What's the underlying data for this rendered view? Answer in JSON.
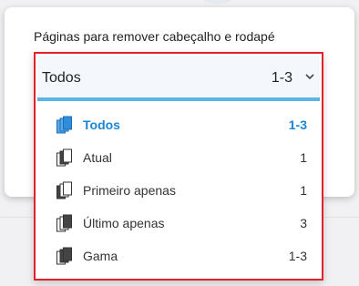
{
  "dialog": {
    "title": "Páginas para remover cabeçalho e rodapé"
  },
  "select": {
    "value": "Todos",
    "count": "1-3",
    "options": [
      {
        "label": "Todos",
        "count": "1-3",
        "icon": "pages-all-icon",
        "selected": true
      },
      {
        "label": "Atual",
        "count": "1",
        "icon": "page-current-icon",
        "selected": false
      },
      {
        "label": "Primeiro apenas",
        "count": "1",
        "icon": "page-first-icon",
        "selected": false
      },
      {
        "label": "Último apenas",
        "count": "3",
        "icon": "page-last-icon",
        "selected": false
      },
      {
        "label": "Gama",
        "count": "1-3",
        "icon": "page-range-icon",
        "selected": false
      }
    ]
  },
  "colors": {
    "accent": "#1a86d4",
    "highlight_border": "#e4202a",
    "underline": "#5ab4e5"
  }
}
